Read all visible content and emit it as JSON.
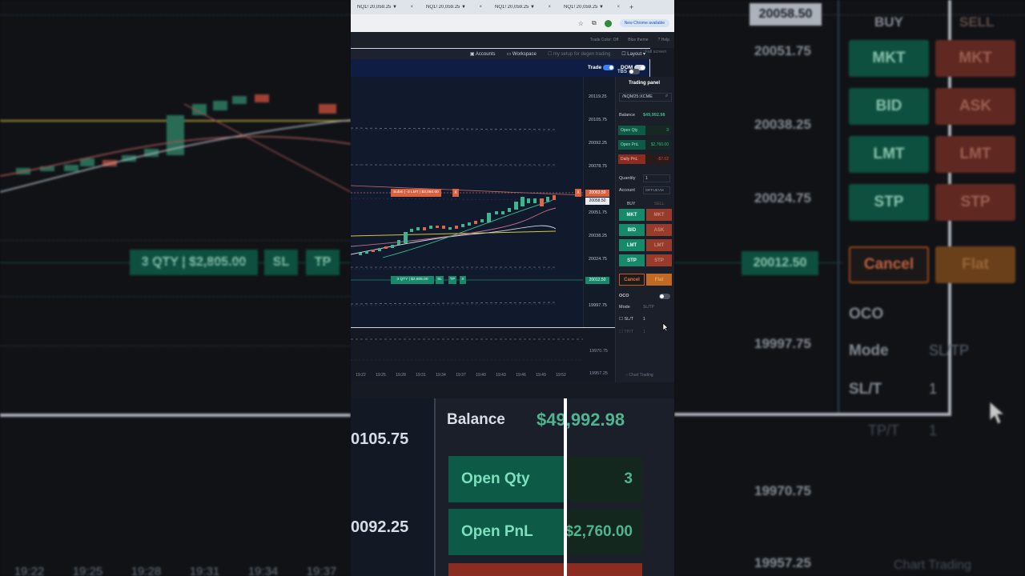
{
  "browser": {
    "tabs": [
      {
        "label": "NQ1! 20,059.25 ▼"
      },
      {
        "label": "NQ1! 20,059.25 ▼"
      },
      {
        "label": "NQ1! 20,059.25 ▼"
      },
      {
        "label": "NQ1! 20,059.25 ▼"
      }
    ],
    "update_label": "New Chrome available"
  },
  "app_header": {
    "trade_color": "Trade Color: Off",
    "theme": "Blue theme",
    "help": "Help"
  },
  "toolbar": {
    "accounts": "Accounts",
    "workspace": "Workspace",
    "layout_name": "my setup for degen trading",
    "layout": "Layout",
    "fullscreen": "Full screen"
  },
  "chart_header": {
    "trade_label": "Trade",
    "dom_label": "DOM",
    "tbs_label": "TBS"
  },
  "chart": {
    "y_ticks": [
      "20119.25",
      "20105.75",
      "20092.25",
      "20078.75",
      "20051.75",
      "20038.25",
      "20024.75",
      "19997.75",
      "19970.75",
      "19957.25"
    ],
    "last_price": "20058.50",
    "order_price": "20063.50",
    "position_price": "20012.50",
    "order_label": "Subm | -3 LMT | $3,060.00",
    "position_label": "3 QTY | $2,805.00",
    "sl": "SL",
    "tp": "TP",
    "close": "X",
    "x_ticks": [
      "19:22",
      "19:25",
      "19:28",
      "19:31",
      "19:34",
      "19:37",
      "19:40",
      "19:43",
      "19:46",
      "19:49",
      "19:52"
    ],
    "chart_trading": "Chart Trading"
  },
  "panel": {
    "title": "Trading panel",
    "symbol": "/NQM25:XCME",
    "balance_label": "Balance",
    "balance_value": "$49,992.98",
    "open_qty_label": "Open Qty",
    "open_qty_value": "3",
    "open_pnl_label": "Open PnL",
    "open_pnl_value": "$2,760.00",
    "daily_pnl_label": "Daily PnL",
    "daily_pnl_value": "-$7.02",
    "quantity_label": "Quantity",
    "quantity_value": "1",
    "account_label": "Account",
    "account_value": "MFFUEVM",
    "buy_header": "BUY",
    "sell_header": "SELL",
    "buy_buttons": [
      "MKT",
      "BID",
      "LMT",
      "STP"
    ],
    "sell_buttons": [
      "MKT",
      "ASK",
      "LMT",
      "STP"
    ],
    "cancel": "Cancel",
    "flat": "Flat",
    "oco": "OCO",
    "mode_label": "Mode",
    "mode_value": "SL/TP",
    "slt_label": "SL/T",
    "slt_value": "1",
    "tpt_label": "TP/T",
    "tpt_value": "1"
  },
  "zoom": {
    "y_ticks": [
      "0105.75",
      "0092.25"
    ],
    "balance_label": "Balance",
    "balance_value": "$49,992.98",
    "open_qty_label": "Open Qty",
    "open_qty_value": "3",
    "open_pnl_label": "Open PnL",
    "open_pnl_value": "$2,760.00"
  },
  "bg_right": {
    "prices": [
      "20058.50",
      "20051.75",
      "20038.25",
      "20024.75",
      "20012.50",
      "19997.75",
      "19970.75",
      "19957.25"
    ],
    "buy": "BUY",
    "sell": "SELL",
    "buttons_buy": [
      "MKT",
      "BID",
      "LMT",
      "STP"
    ],
    "buttons_sell": [
      "MKT",
      "ASK",
      "LMT",
      "STP"
    ],
    "cancel": "Cancel",
    "flat": "Flat",
    "oco": "OCO",
    "mode": "Mode",
    "mode_value": "SL/TP",
    "slt": "SL/T",
    "slt_value": "1",
    "tpt": "TP/T",
    "tpt_value": "1",
    "chart_trading": "Chart Trading"
  },
  "bg_left": {
    "position_label": "3 QTY | $2,805.00",
    "sl": "SL",
    "tp": "TP",
    "x_ticks": [
      "19:22",
      "19:25",
      "19:28",
      "19:31",
      "19:34",
      "19:37"
    ]
  },
  "colors": {
    "buy": "#16896a",
    "sell": "#b8432b",
    "accent": "#3b82f6",
    "header": "#0f1d45"
  }
}
